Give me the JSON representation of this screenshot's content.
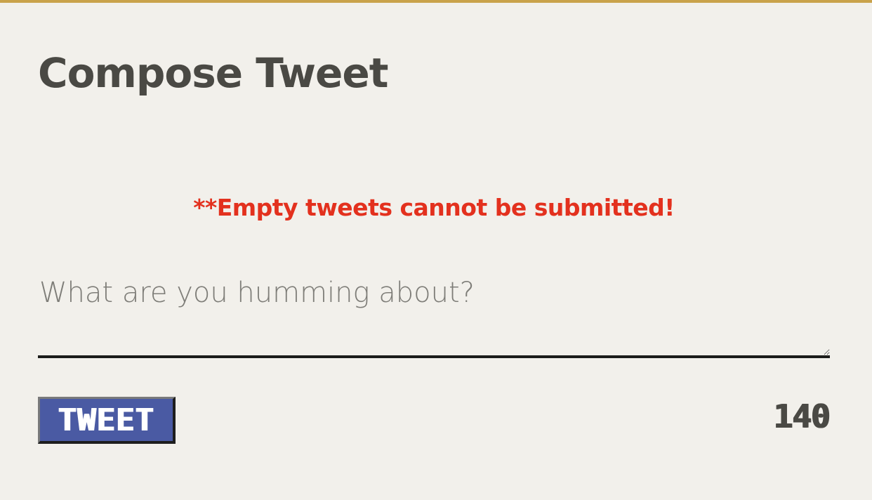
{
  "compose": {
    "title": "Compose Tweet",
    "error_message": "**Empty tweets cannot be submitted!",
    "textarea": {
      "value": "",
      "placeholder": "What are you humming about?"
    },
    "button_label": "TWEET",
    "char_counter": "140"
  },
  "colors": {
    "background": "#f2f0eb",
    "top_rule": "#c9a24a",
    "title_text": "#4a4944",
    "error_text": "#e3311e",
    "button_bg": "#4a5aa3",
    "underline": "#1c1c1a"
  }
}
